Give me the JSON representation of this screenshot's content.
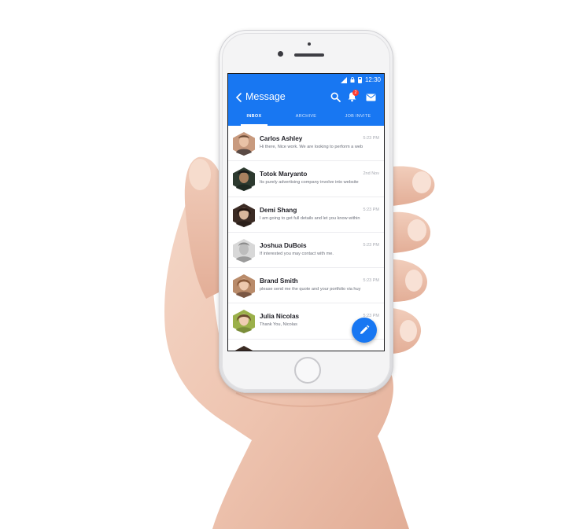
{
  "status_bar": {
    "time": "12:30"
  },
  "appbar": {
    "title": "Message",
    "notification_count": "2",
    "color": "#1877f2"
  },
  "tabs": [
    {
      "label": "INBOX",
      "active": true
    },
    {
      "label": "ARCHIVE",
      "active": false
    },
    {
      "label": "JOB INVITE",
      "active": false
    }
  ],
  "messages": [
    {
      "name": "Carlos Ashley",
      "time": "5:23 PM",
      "preview": "Hi there, Nice work. We are looking to perform a web"
    },
    {
      "name": "Totok Maryanto",
      "time": "2nd Nov",
      "preview": "Its purely advertising company involve into website"
    },
    {
      "name": "Demi Shang",
      "time": "5:23 PM",
      "preview": "I am going to get full details and let you know within"
    },
    {
      "name": "Joshua DuBois",
      "time": "5:23 PM",
      "preview": "If interested you may contact with me."
    },
    {
      "name": "Brand Smith",
      "time": "5:23 PM",
      "preview": "please send me the quote and your portfolio via huy"
    },
    {
      "name": "Julia Nicolas",
      "time": "5:23 PM",
      "preview": "Thank You, Nicolas"
    }
  ],
  "icons": {
    "back": "chevron-left-icon",
    "search": "search-icon",
    "notifications": "bell-icon",
    "mail": "mail-icon",
    "compose": "pencil-icon"
  }
}
